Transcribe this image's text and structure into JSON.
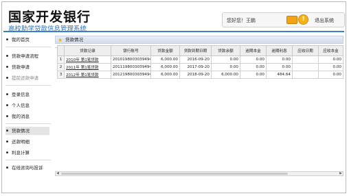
{
  "header": {
    "bank_name": "国家开发银行",
    "system_name": "高校助学贷款信息管理系统",
    "welcome": "您好您！王鹏",
    "logout_label": "退出系统"
  },
  "sidebar": {
    "items": [
      {
        "label": "我的首页",
        "state": "normal"
      },
      {
        "label": "贷款申请流程",
        "state": "normal"
      },
      {
        "label": "贷款申请",
        "state": "normal"
      },
      {
        "label": "提前还款申请",
        "state": "muted"
      },
      {
        "label": "登录信息",
        "state": "normal"
      },
      {
        "label": "个人信息",
        "state": "normal"
      },
      {
        "label": "我的消息",
        "state": "normal"
      },
      {
        "label": "贷款情况",
        "state": "active"
      },
      {
        "label": "还款明细",
        "state": "normal"
      },
      {
        "label": "利息计算",
        "state": "normal"
      },
      {
        "label": "在线咨询与投诉",
        "state": "normal"
      }
    ]
  },
  "panel": {
    "title": "贷款情况"
  },
  "table": {
    "columns": [
      "",
      "贷款记录",
      "银行账号",
      "贷款金额",
      "贷款到期日期",
      "贷款余额",
      "逾期本金",
      "逾期利息",
      "应收日期",
      "应收本金"
    ],
    "rows": [
      [
        "1",
        "2010年 第1笔贷款",
        "2010198003039494",
        "6,000.00",
        "2016-09-20",
        "0.00",
        "0.00",
        "0.00",
        "",
        "0.00"
      ],
      [
        "2",
        "2011年 第1笔贷款",
        "2011198003039494",
        "6,000.00",
        "2017-09-20",
        "0.00",
        "0.00",
        "0.00",
        "",
        "0.00"
      ],
      [
        "3",
        "2012年 第1笔贷款",
        "2012198003039494",
        "6,000.00",
        "2018-09-20",
        "6,000.00",
        "0.00",
        "484.64",
        "",
        "0.00"
      ]
    ]
  },
  "colors": {
    "accent": "#3b7fc4",
    "subtitle": "#2c73b9",
    "icon_orange": "#f2a318"
  },
  "icons": [
    "mail-icon",
    "info-icon",
    "star-icon",
    "bullet-icon"
  ]
}
